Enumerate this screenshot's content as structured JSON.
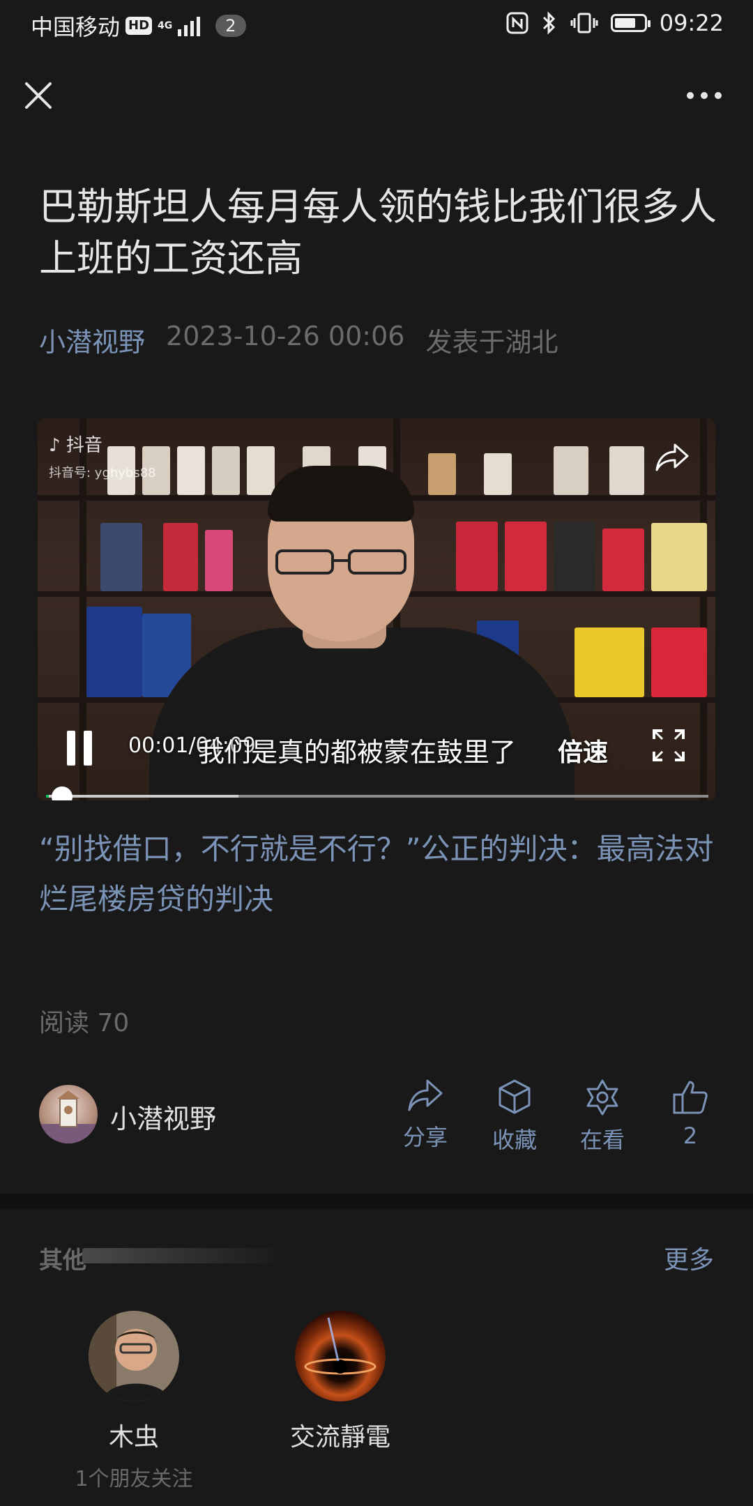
{
  "status_bar": {
    "carrier": "中国移动",
    "hd": "HD",
    "network": "4G",
    "notification_count": "2",
    "time": "09:22",
    "battery_level": 0.7
  },
  "article": {
    "title": "巴勒斯坦人每月每人领的钱比我们很多人上班的工资还高",
    "author": "小潜视野",
    "date": "2023-10-26 00:06",
    "location": "发表于湖北"
  },
  "video": {
    "watermark_app": "抖音",
    "watermark_id": "抖音号: yghybs88",
    "time_display": "00:01/04:09",
    "subtitle": "我们是真的都被蒙在鼓里了",
    "speed_label": "倍速",
    "progress": 0.004,
    "buffered": 0.29
  },
  "related_title": "“别找借口，不行就是不行？”公正的判决：最高法对烂尾楼房贷的判决",
  "read_count": "阅读 70",
  "author_row": {
    "name": "小潜视野",
    "share_label": "分享",
    "collect_label": "收藏",
    "watching_label": "在看",
    "like_count": "2"
  },
  "others": {
    "label": "其他",
    "more_label": "更多",
    "friends": [
      {
        "name": "木虫",
        "sub": "1个朋友关注"
      },
      {
        "name": "交流靜電",
        "sub": ""
      }
    ]
  },
  "colors": {
    "background": "#191919",
    "link": "#7c93b8",
    "muted": "#6a6a6a",
    "progress": "#07c160"
  }
}
